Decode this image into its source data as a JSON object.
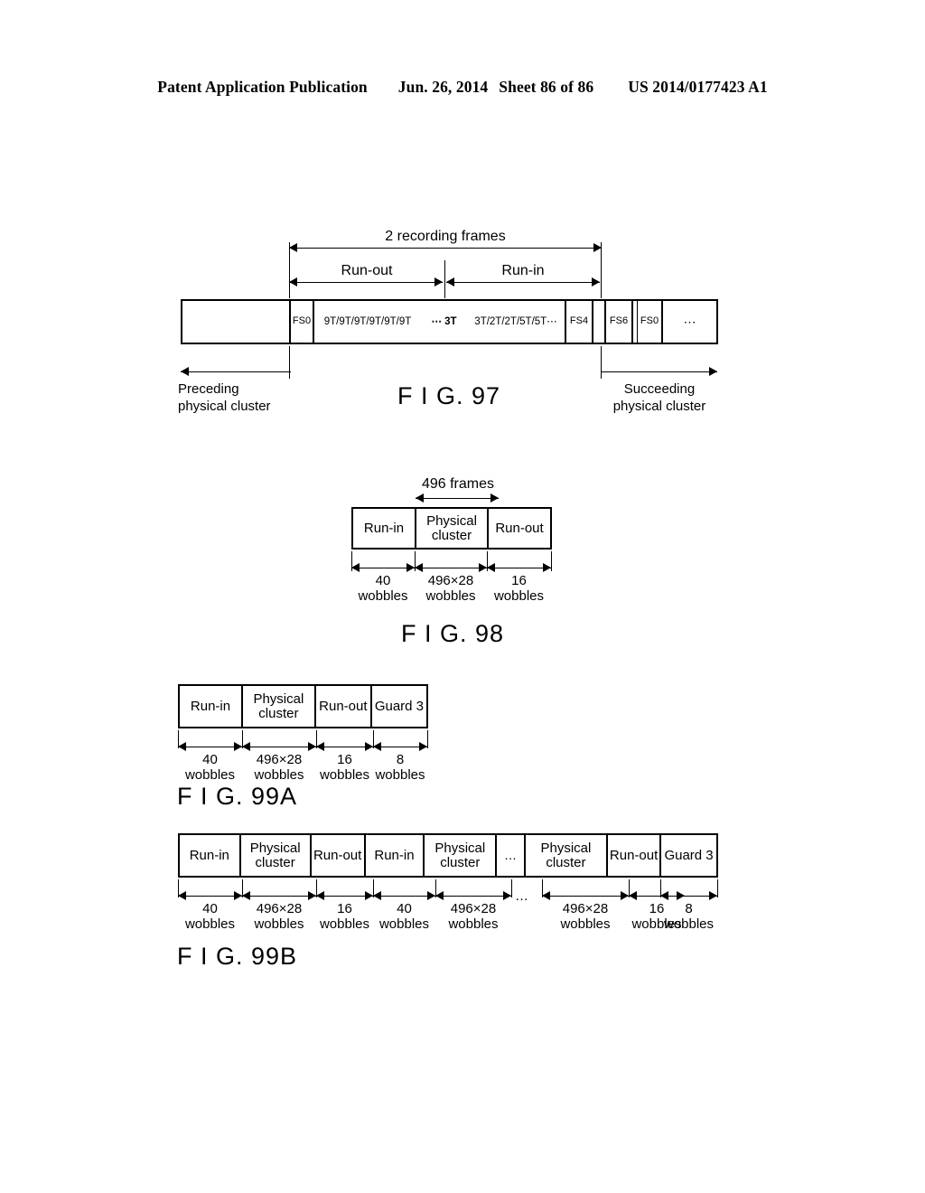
{
  "header": {
    "publication": "Patent Application Publication",
    "date": "Jun. 26, 2014",
    "sheet": "Sheet 86 of 86",
    "patent_number": "US 2014/0177423 A1"
  },
  "fig97": {
    "label": "F I G. 97",
    "top_span_label": "2 recording frames",
    "run_out_label": "Run-out",
    "run_in_label": "Run-in",
    "cells": [
      {
        "text": ""
      },
      {
        "text": "FS0"
      },
      {
        "text": "9T/9T/9T/9T/9T/9T"
      },
      {
        "text": "⋯ 3T"
      },
      {
        "text": "3T/2T/2T/5T/5T⋯"
      },
      {
        "text": "FS4"
      },
      {
        "text": ""
      },
      {
        "text": "FS6"
      },
      {
        "text": ""
      },
      {
        "text": "FS0"
      },
      {
        "text": "⋯"
      }
    ],
    "preceding_label_line1": "Preceding",
    "preceding_label_line2": "physical cluster",
    "succeeding_label_line1": "Succeeding",
    "succeeding_label_line2": "physical cluster"
  },
  "fig98": {
    "label": "F I G. 98",
    "top_span_label": "496 frames",
    "cells": [
      {
        "text": "Run-in",
        "dim_value": "40",
        "dim_unit": "wobbles"
      },
      {
        "text": "Physical\ncluster",
        "dim_value": "496×28",
        "dim_unit": "wobbles"
      },
      {
        "text": "Run-out",
        "dim_value": "16",
        "dim_unit": "wobbles"
      }
    ]
  },
  "fig99a": {
    "label": "F I G. 99A",
    "cells": [
      {
        "text": "Run-in",
        "dim_value": "40",
        "dim_unit": "wobbles"
      },
      {
        "text": "Physical\ncluster",
        "dim_value": "496×28",
        "dim_unit": "wobbles"
      },
      {
        "text": "Run-out",
        "dim_value": "16",
        "dim_unit": "wobbles"
      },
      {
        "text": "Guard 3",
        "dim_value": "8",
        "dim_unit": "wobbles"
      }
    ]
  },
  "fig99b": {
    "label": "F I G. 99B",
    "ellipsis": "…",
    "cells": [
      {
        "text": "Run-in",
        "dim_value": "40",
        "dim_unit": "wobbles"
      },
      {
        "text": "Physical\ncluster",
        "dim_value": "496×28",
        "dim_unit": "wobbles"
      },
      {
        "text": "Run-out",
        "dim_value": "16",
        "dim_unit": "wobbles"
      },
      {
        "text": "Run-in",
        "dim_value": "40",
        "dim_unit": "wobbles"
      },
      {
        "text": "Physical\ncluster",
        "dim_value": "496×28",
        "dim_unit": "wobbles"
      },
      {
        "text": "…",
        "dim_value": "",
        "dim_unit": ""
      },
      {
        "text": "Physical\ncluster",
        "dim_value": "496×28",
        "dim_unit": "wobbles"
      },
      {
        "text": "Run-out",
        "dim_value": "16",
        "dim_unit": "wobbles"
      },
      {
        "text": "Guard 3",
        "dim_value": "8",
        "dim_unit": "wobbles"
      }
    ]
  }
}
